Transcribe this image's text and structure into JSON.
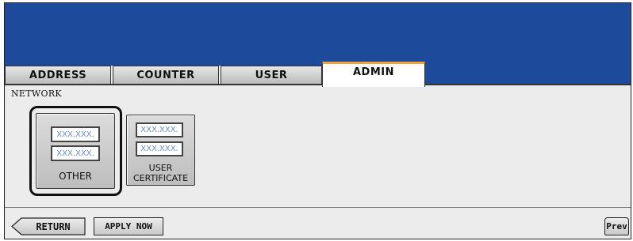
{
  "tabs": [
    {
      "label": "ADDRESS",
      "active": false
    },
    {
      "label": "COUNTER",
      "active": false
    },
    {
      "label": "USER",
      "active": false
    },
    {
      "label": "ADMIN",
      "active": true
    }
  ],
  "section": {
    "title": "NETWORK"
  },
  "buttons": {
    "other": {
      "label": "OTHER",
      "field_text": "XXX.XXX."
    },
    "user_certificate": {
      "label_line1": "USER",
      "label_line2": "CERTIFICATE",
      "field_text": "XXX.XXX."
    }
  },
  "footer": {
    "return_label": "RETURN",
    "apply_label": "APPLY NOW",
    "prev_label": "Prev"
  },
  "colors": {
    "banner": "#1e4a9c",
    "active_tab_accent": "#f3a23e",
    "field_text": "#6a8fd8"
  }
}
